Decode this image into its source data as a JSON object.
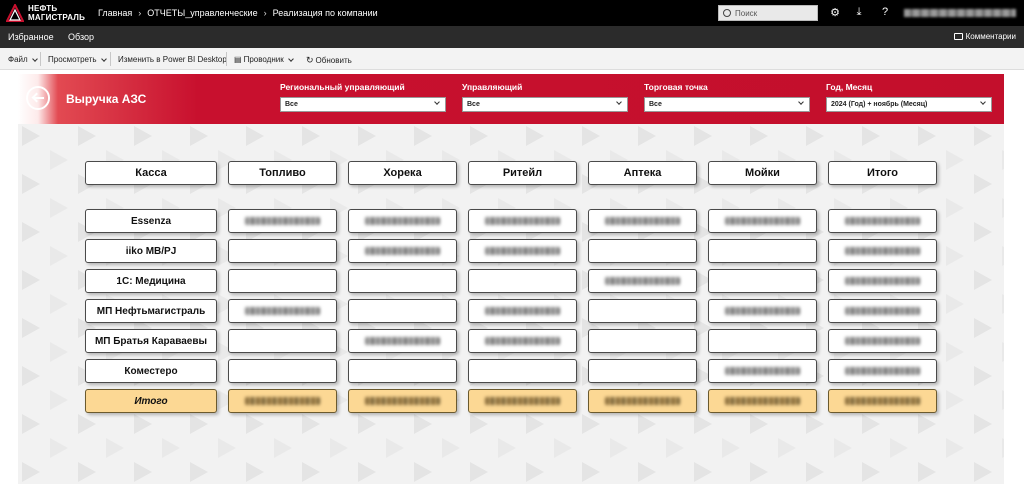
{
  "topbar": {
    "logo_line1": "НЕФТЬ",
    "logo_line2": "МАГИСТРАЛЬ",
    "breadcrumb": [
      "Главная",
      "ОТЧЕТЫ_управленческие",
      "Реализация по компании"
    ],
    "search_placeholder": "Поиск",
    "icons": [
      "gear-icon",
      "download-icon",
      "help-icon"
    ]
  },
  "navbar": {
    "items": [
      "Избранное",
      "Обзор"
    ],
    "comments_label": "Комментарии"
  },
  "toolbar": {
    "file": "Файл",
    "view": "Просмотреть",
    "edit_in_desktop": "Изменить в Power BI Desktop",
    "explorer": "Проводник",
    "refresh": "Обновить"
  },
  "report": {
    "title": "Выручка АЗС",
    "slicers": [
      {
        "label": "Региональный управляющий",
        "value": "Все"
      },
      {
        "label": "Управляющий",
        "value": "Все"
      },
      {
        "label": "Торговая точка",
        "value": "Все"
      },
      {
        "label": "Год, Месяц",
        "value": "2024 (Год) + ноябрь (Месяц)"
      }
    ],
    "corner_header": "Касса",
    "columns": [
      "Топливо",
      "Хорека",
      "Ритейл",
      "Аптека",
      "Мойки",
      "Итого"
    ],
    "rows": [
      {
        "label": "Essenza",
        "filled": [
          true,
          true,
          true,
          true,
          true,
          true
        ]
      },
      {
        "label": "iiko MB/PJ",
        "filled": [
          false,
          true,
          true,
          false,
          false,
          true
        ]
      },
      {
        "label": "1С: Медицина",
        "filled": [
          false,
          false,
          false,
          true,
          false,
          true
        ]
      },
      {
        "label": "МП Нефтьмагистраль",
        "filled": [
          true,
          false,
          true,
          false,
          true,
          true
        ]
      },
      {
        "label": "МП Братья Караваевы",
        "filled": [
          false,
          true,
          true,
          false,
          false,
          true
        ]
      },
      {
        "label": "Коместеро",
        "filled": [
          false,
          false,
          false,
          false,
          true,
          true
        ]
      }
    ],
    "total_label": "Итого",
    "total_filled": [
      true,
      true,
      true,
      true,
      true,
      true
    ]
  },
  "colors": {
    "brand_red": "#c8102e",
    "total_fill": "#fcd894",
    "topbar": "#000000",
    "navbar": "#2b2b2b"
  }
}
